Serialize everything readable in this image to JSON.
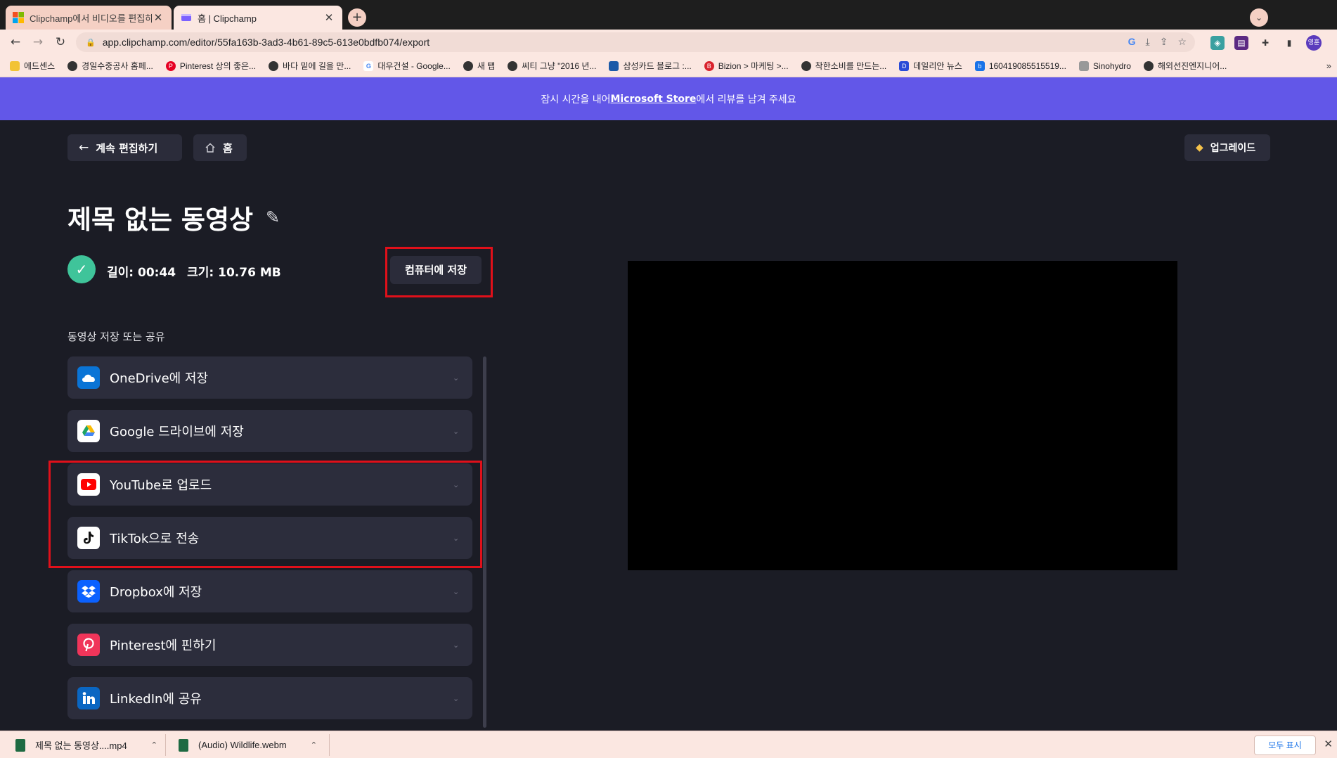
{
  "browser": {
    "tabs": [
      {
        "title": "Clipchamp에서 비디오를 편집하",
        "active": false
      },
      {
        "title": "홈 | Clipchamp",
        "active": true
      }
    ],
    "url": "app.clipchamp.com/editor/55fa163b-3ad3-4b61-89c5-613e0bdfb074/export",
    "profile_initials": "영훈",
    "bookmarks": [
      {
        "label": "에드센스",
        "color": "#f2c335"
      },
      {
        "label": "경일수중공사 홈페...",
        "color": "#333333"
      },
      {
        "label": "Pinterest 상의 좋은...",
        "color": "#e60023"
      },
      {
        "label": "바다 밑에 길을 만...",
        "color": "#333333"
      },
      {
        "label": "대우건설 - Google...",
        "color": "#4285f4"
      },
      {
        "label": "새 탭",
        "color": "#333333"
      },
      {
        "label": "씨티 그냥 \"2016 년...",
        "color": "#333333"
      },
      {
        "label": "삼성카드 블로그 :...",
        "color": "#1c5aa8"
      },
      {
        "label": "Bizion > 마케팅 >...",
        "color": "#d9232d"
      },
      {
        "label": "착한소비를 만드는...",
        "color": "#333333"
      },
      {
        "label": "데일리안 뉴스",
        "color": "#2a4bd7"
      },
      {
        "label": "160419085515519...",
        "color": "#1a73e8"
      },
      {
        "label": "Sinohydro",
        "color": "#777777"
      },
      {
        "label": "해외선진엔지니어...",
        "color": "#333333"
      }
    ]
  },
  "banner": {
    "prefix": "잠시 시간을 내어 ",
    "link": "Microsoft Store",
    "suffix": "에서 리뷰를 남겨 주세요"
  },
  "header": {
    "back_label": "계속 편집하기",
    "home_label": "홈",
    "upgrade_label": "업그레이드"
  },
  "video": {
    "title": "제목 없는 동영상",
    "length": "길이: 00:44",
    "size": "크기: 10.76 MB",
    "save_pc_label": "컴퓨터에 저장"
  },
  "share": {
    "section_label": "동영상 저장 또는 공유",
    "items": [
      {
        "label": "OneDrive에 저장",
        "icon": "onedrive-icon",
        "bg": "#0a74d6"
      },
      {
        "label": "Google 드라이브에 저장",
        "icon": "google-drive-icon",
        "bg": "#ffffff"
      },
      {
        "label": "YouTube로 업로드",
        "icon": "youtube-icon",
        "bg": "#ffffff"
      },
      {
        "label": "TikTok으로 전송",
        "icon": "tiktok-icon",
        "bg": "#ffffff"
      },
      {
        "label": "Dropbox에 저장",
        "icon": "dropbox-icon",
        "bg": "#0b61ff"
      },
      {
        "label": "Pinterest에 핀하기",
        "icon": "pinterest-icon",
        "bg": "#f0355a"
      },
      {
        "label": "LinkedIn에 공유",
        "icon": "linkedin-icon",
        "bg": "#0a66c2"
      }
    ]
  },
  "downloads": {
    "items": [
      {
        "name": "제목 없는 동영상....mp4"
      },
      {
        "name": "(Audio) Wildlife.webm"
      }
    ],
    "show_all": "모두 표시"
  },
  "colors": {
    "accent": "#6257e8",
    "background": "#1b1c25",
    "card": "#2c2d3c",
    "success": "#3fc49a",
    "highlight": "#e0101a"
  }
}
